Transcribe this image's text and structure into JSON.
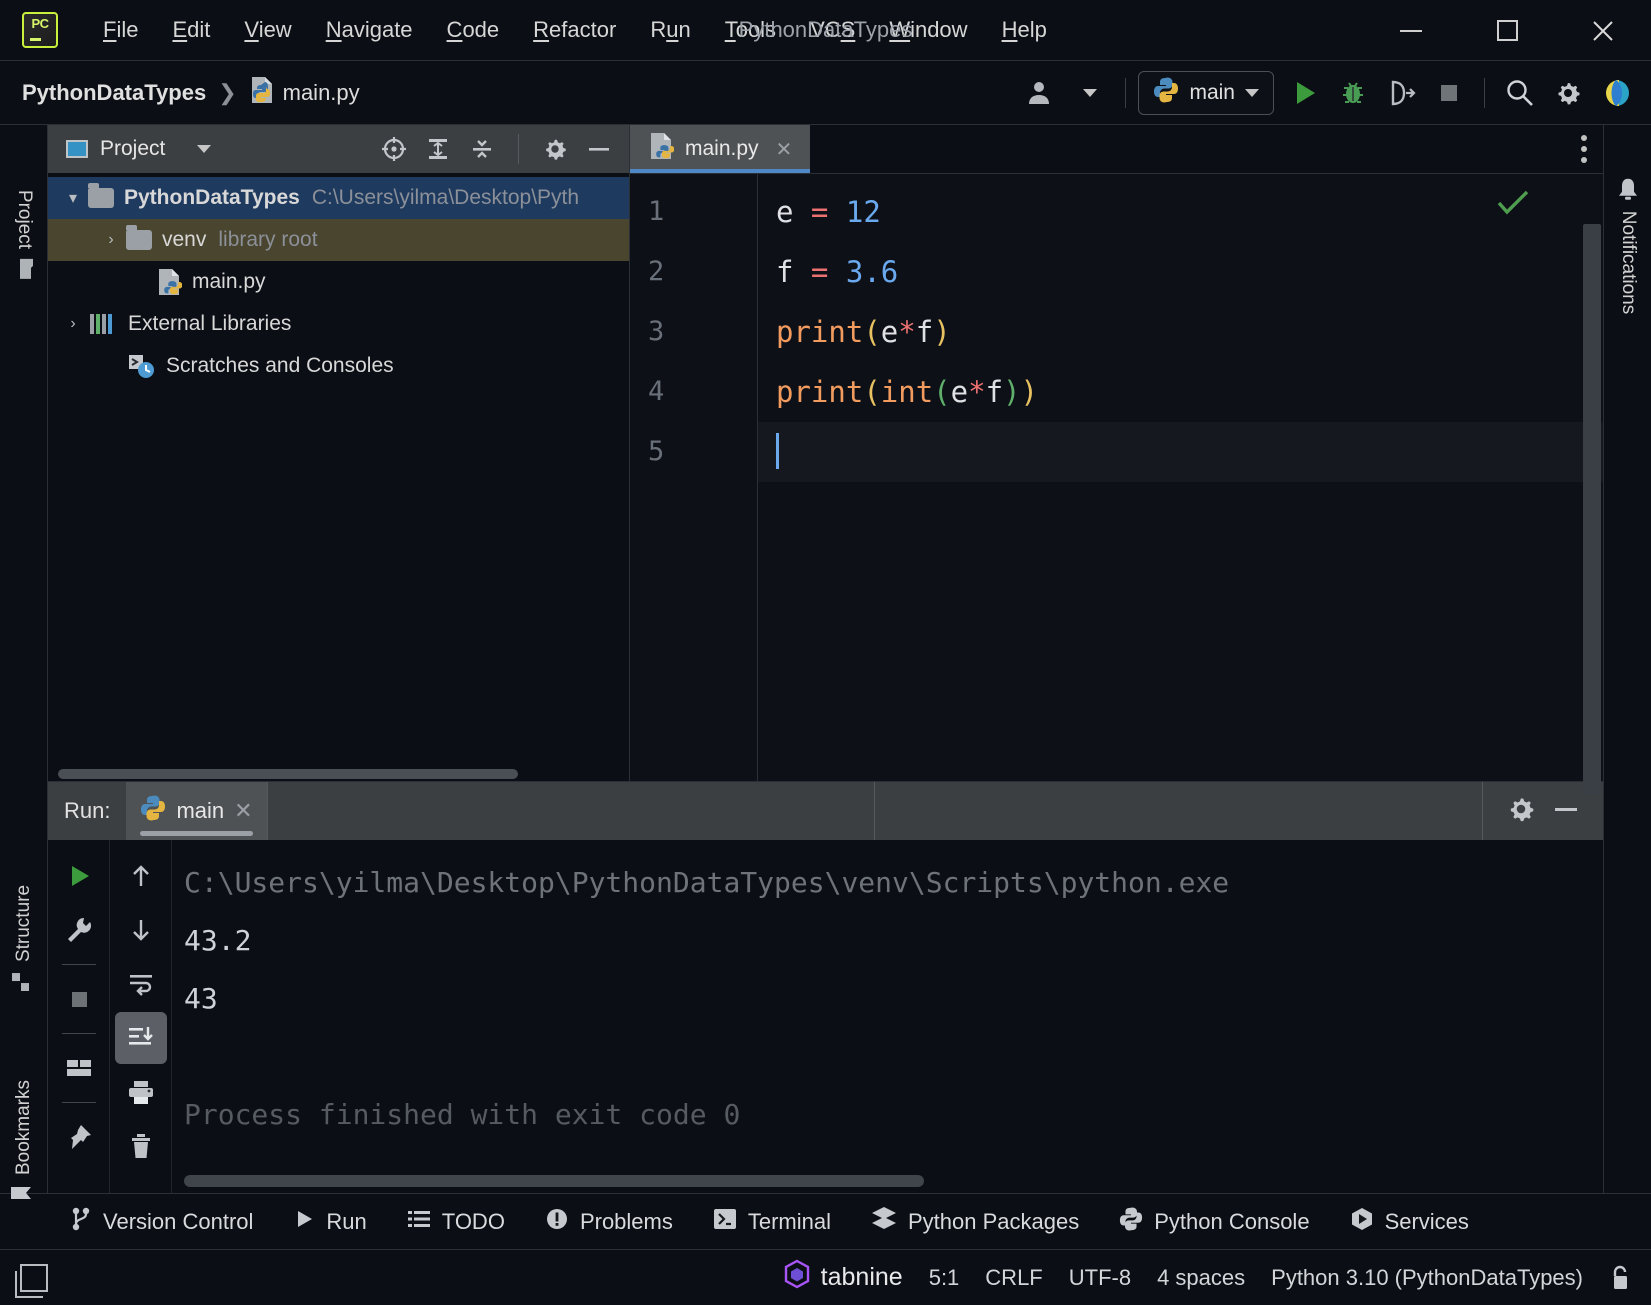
{
  "window": {
    "title": "PythonDataTypes",
    "minimize": "—",
    "maximize": "□",
    "close": "✕"
  },
  "menubar": {
    "items": [
      {
        "label": "File",
        "mnemonic": "F"
      },
      {
        "label": "Edit",
        "mnemonic": "E"
      },
      {
        "label": "View",
        "mnemonic": "V"
      },
      {
        "label": "Navigate",
        "mnemonic": "N"
      },
      {
        "label": "Code",
        "mnemonic": "C"
      },
      {
        "label": "Refactor",
        "mnemonic": "R"
      },
      {
        "label": "Run",
        "mnemonic": "u"
      },
      {
        "label": "Tools",
        "mnemonic": "T"
      },
      {
        "label": "VCS",
        "mnemonic": "S"
      },
      {
        "label": "Window",
        "mnemonic": "W"
      },
      {
        "label": "Help",
        "mnemonic": "H"
      }
    ]
  },
  "navbar": {
    "breadcrumb_project": "PythonDataTypes",
    "breadcrumb_separator": "❯",
    "breadcrumb_file": "main.py",
    "run_config": "main",
    "icons": [
      "user-avatar-icon",
      "run-icon",
      "debug-icon",
      "run-coverage-icon",
      "stop-icon",
      "search-icon",
      "settings-icon",
      "updates-icon"
    ]
  },
  "left_rail": {
    "project_label": "Project",
    "structure_label": "Structure",
    "bookmarks_label": "Bookmarks"
  },
  "right_rail": {
    "notifications_label": "Notifications"
  },
  "project_panel": {
    "title": "Project",
    "toolbar_icons": [
      "select-opened-file-icon",
      "expand-all-icon",
      "collapse-all-icon",
      "settings-icon",
      "hide-icon"
    ],
    "tree": [
      {
        "label": "PythonDataTypes",
        "detail": "C:\\Users\\yilma\\Desktop\\Pyth",
        "arrow": "▾",
        "icon": "folder-icon",
        "depth": 0,
        "selected": true,
        "bold": true
      },
      {
        "label": "venv",
        "detail": "library root",
        "arrow": "›",
        "icon": "folder-icon",
        "depth": 1,
        "selected2": true,
        "bold": false
      },
      {
        "label": "main.py",
        "detail": "",
        "arrow": "",
        "icon": "python-file-icon",
        "depth": 2,
        "bold": false
      },
      {
        "label": "External Libraries",
        "detail": "",
        "arrow": "›",
        "icon": "libraries-icon",
        "depth": 0,
        "bold": false
      },
      {
        "label": "Scratches and Consoles",
        "detail": "",
        "arrow": "",
        "icon": "scratches-icon",
        "depth": 1,
        "bold": false
      }
    ]
  },
  "editor": {
    "tab_label": "main.py",
    "tab_close": "✕",
    "more_actions": "options-icon",
    "inspection_status": "check-icon",
    "lines": [
      {
        "num": "1",
        "tokens": [
          {
            "t": "e ",
            "c": "c-def"
          },
          {
            "t": "=",
            "c": "c-op"
          },
          {
            "t": " ",
            "c": "c-def"
          },
          {
            "t": "12",
            "c": "c-num"
          }
        ]
      },
      {
        "num": "2",
        "tokens": [
          {
            "t": "f ",
            "c": "c-def"
          },
          {
            "t": "=",
            "c": "c-op"
          },
          {
            "t": " ",
            "c": "c-def"
          },
          {
            "t": "3.6",
            "c": "c-num"
          }
        ]
      },
      {
        "num": "3",
        "tokens": [
          {
            "t": "print",
            "c": "c-fn"
          },
          {
            "t": "(",
            "c": "c-par1"
          },
          {
            "t": "e",
            "c": "c-def"
          },
          {
            "t": "*",
            "c": "c-op"
          },
          {
            "t": "f",
            "c": "c-def"
          },
          {
            "t": ")",
            "c": "c-par1"
          }
        ]
      },
      {
        "num": "4",
        "tokens": [
          {
            "t": "print",
            "c": "c-fn"
          },
          {
            "t": "(",
            "c": "c-par1"
          },
          {
            "t": "int",
            "c": "c-fn"
          },
          {
            "t": "(",
            "c": "c-par2"
          },
          {
            "t": "e",
            "c": "c-def"
          },
          {
            "t": "*",
            "c": "c-op"
          },
          {
            "t": "f",
            "c": "c-def"
          },
          {
            "t": ")",
            "c": "c-par2"
          },
          {
            "t": ")",
            "c": "c-par1"
          }
        ]
      },
      {
        "num": "5",
        "tokens": []
      }
    ]
  },
  "run_panel": {
    "label": "Run:",
    "tab_label": "main",
    "tab_close": "✕",
    "toolbar_left": [
      "rerun-icon",
      "modify-run-configuration-icon",
      "stop-icon",
      "layout-icon",
      "pin-icon"
    ],
    "toolbar_right": [
      "up-arrow-icon",
      "down-arrow-icon",
      "soft-wrap-icon",
      "scroll-to-end-icon",
      "print-icon",
      "trash-icon"
    ],
    "header_icons": [
      "settings-icon",
      "hide-icon"
    ],
    "console": [
      {
        "text": "C:\\Users\\yilma\\Desktop\\PythonDataTypes\\venv\\Scripts\\python.exe",
        "kind": "path"
      },
      {
        "text": "43.2",
        "kind": "out"
      },
      {
        "text": "43",
        "kind": "out"
      },
      {
        "text": "",
        "kind": "out"
      },
      {
        "text": "Process finished with exit code 0",
        "kind": "fin"
      }
    ]
  },
  "toolwindow_bar": {
    "items": [
      {
        "label": "Version Control",
        "icon": "branch-icon"
      },
      {
        "label": "Run",
        "icon": "run-icon"
      },
      {
        "label": "TODO",
        "icon": "list-icon"
      },
      {
        "label": "Problems",
        "icon": "warning-icon"
      },
      {
        "label": "Terminal",
        "icon": "terminal-icon"
      },
      {
        "label": "Python Packages",
        "icon": "packages-icon"
      },
      {
        "label": "Python Console",
        "icon": "python-icon"
      },
      {
        "label": "Services",
        "icon": "services-icon"
      }
    ]
  },
  "status_bar": {
    "left_icon": "show-tool-windows-icon",
    "plugin": "tabnine",
    "caret_position": "5:1",
    "line_separator": "CRLF",
    "encoding": "UTF-8",
    "indent": "4 spaces",
    "interpreter": "Python 3.10 (PythonDataTypes)",
    "lock_icon": "unlocked-icon"
  }
}
